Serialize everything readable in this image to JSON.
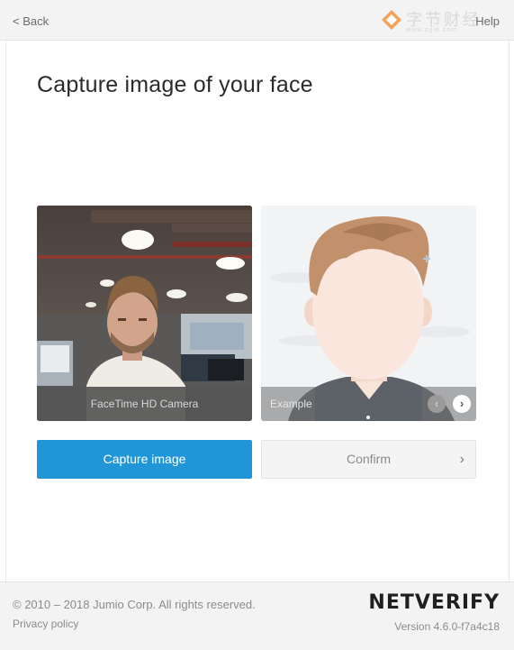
{
  "topbar": {
    "back_label": "< Back",
    "help_label": "Help"
  },
  "watermark": {
    "text": "字节财经",
    "url": "www.zijie.com"
  },
  "page": {
    "title": "Capture image of your face"
  },
  "camera": {
    "caption": "FaceTime HD Camera"
  },
  "example": {
    "label": "Example",
    "prev_icon": "‹",
    "next_icon": "›"
  },
  "actions": {
    "capture_label": "Capture image",
    "confirm_label": "Confirm",
    "confirm_chevron": "›"
  },
  "footer": {
    "copyright": "© 2010 – 2018 Jumio Corp. All rights reserved.",
    "privacy": "Privacy policy",
    "brand": "NETVERIFY",
    "version": "Version 4.6.0-f7a4c18"
  },
  "colors": {
    "accent": "#2196d6",
    "topbar_bg": "#f3f3f3",
    "text": "#2b2b2b"
  }
}
